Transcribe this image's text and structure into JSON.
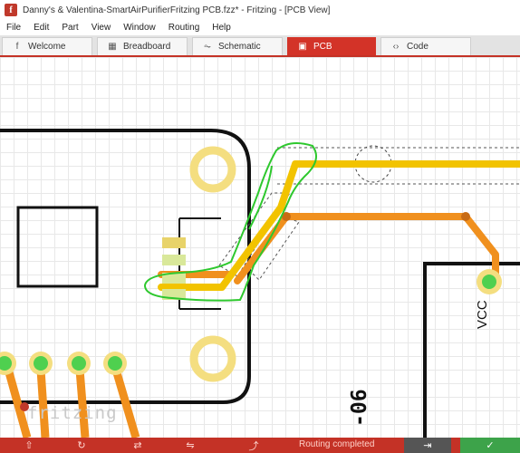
{
  "window": {
    "app_icon": "f",
    "title": "Danny's & Valentina-SmartAirPurifierFritzing PCB.fzz* - Fritzing - [PCB View]"
  },
  "menu": [
    "File",
    "Edit",
    "Part",
    "View",
    "Window",
    "Routing",
    "Help"
  ],
  "tabs": [
    {
      "label": "Welcome",
      "icon": "f"
    },
    {
      "label": "Breadboard",
      "icon": "▦"
    },
    {
      "label": "Schematic",
      "icon": "⏦"
    },
    {
      "label": "PCB",
      "icon": "▣"
    },
    {
      "label": "Code",
      "icon": "‹›"
    }
  ],
  "active_tab": "PCB",
  "canvas": {
    "watermark": "fritzing",
    "silk_labels": {
      "vcc": "VCC",
      "part": "-06"
    }
  },
  "status": {
    "message": "Routing completed",
    "export_label": "⇥",
    "share_label": "⇧"
  },
  "colors": {
    "accent": "#c43226",
    "trace_top": "#f2c300",
    "trace_bottom": "#f0901e",
    "pad": "#f4de80",
    "selection": "#2ec82e"
  }
}
